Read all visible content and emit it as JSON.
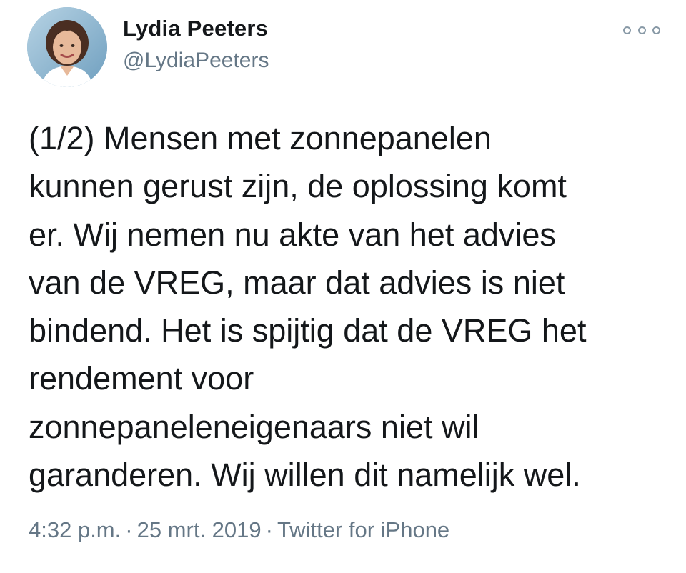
{
  "author": {
    "display_name": "Lydia Peeters",
    "handle": "@LydiaPeeters"
  },
  "tweet": {
    "lines": [
      "(1/2) Mensen met zonnepanelen",
      "kunnen gerust zijn, de oplossing komt",
      "er. Wij nemen nu akte van het advies",
      "van de VREG, maar dat advies is niet",
      "bindend. Het is spijtig dat de VREG het",
      "rendement voor",
      "zonnepaneleneigenaars niet wil",
      "garanderen. Wij willen dit namelijk wel."
    ]
  },
  "meta": {
    "time": "4:32 p.m.",
    "separator": "·",
    "date": "25 mrt. 2019",
    "source": "Twitter for iPhone"
  },
  "icons": {
    "more": "more-options-icon"
  },
  "colors": {
    "text": "#14171a",
    "secondary": "#657786",
    "icon": "#8899a6",
    "background": "#ffffff"
  }
}
